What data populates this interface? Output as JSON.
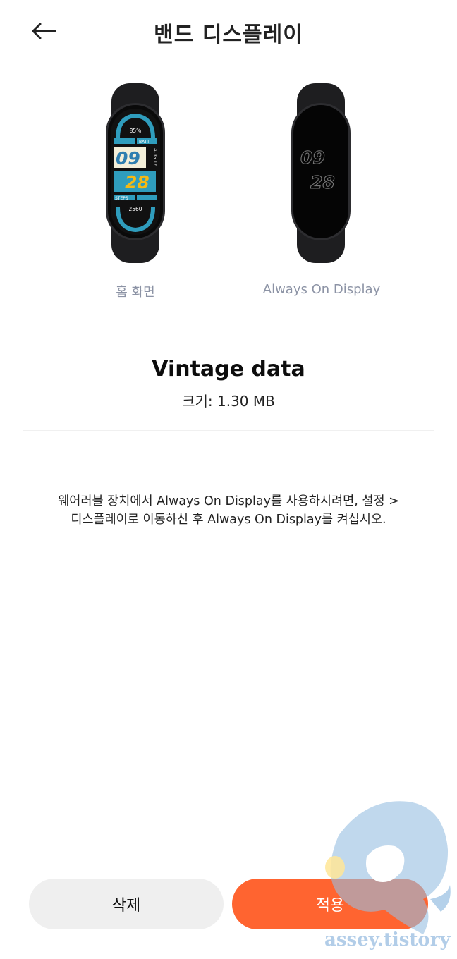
{
  "header": {
    "title": "밴드 디스플레이"
  },
  "previews": {
    "home": {
      "label": "홈 화면",
      "battery_percent": "85%",
      "batt_label": "BATT",
      "hour": "09",
      "minute": "28",
      "date": "AUG 16",
      "steps_label": "STEPS",
      "steps_value": "2560"
    },
    "aod": {
      "label": "Always On Display",
      "hour": "09",
      "minute": "28"
    }
  },
  "face": {
    "name": "Vintage data",
    "size": "크기: 1.30 MB"
  },
  "info_text": {
    "line1": "웨어러블 장치에서 Always On Display를 사용하시려면, 설정 >",
    "line2": "디스플레이로 이동하신 후 Always On Display를 켜십시오."
  },
  "buttons": {
    "delete_label": "삭제",
    "apply_label": "적용"
  },
  "watermark": {
    "text": "assey.tistory"
  },
  "colors": {
    "accent": "#ff6430",
    "secondary_button": "#efefef",
    "muted_label": "#8c93a5"
  }
}
